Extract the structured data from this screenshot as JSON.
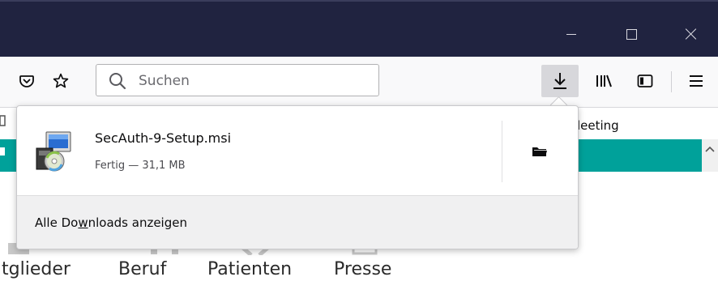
{
  "window": {
    "minimize_label": "—",
    "maximize_label": "□",
    "close_label": "✕"
  },
  "toolbar": {
    "search_placeholder": "Suchen",
    "icons": [
      "pocket-icon",
      "star-icon",
      "search-icon",
      "download-icon",
      "library-icon",
      "sidebar-icon",
      "hamburger-menu-icon"
    ]
  },
  "page": {
    "bookmark_partial": "leeting",
    "nav_links": [
      "tglieder",
      "Beruf",
      "Patienten",
      "Presse"
    ],
    "colors": {
      "teal_bar": "#00a19a",
      "titlebar": "#202340"
    }
  },
  "downloads_panel": {
    "items": [
      {
        "file_name": "SecAuth-9-Setup.msi",
        "status": "Fertig — 31,1 MB"
      }
    ],
    "footer_prefix": "Alle Do",
    "footer_accesskey": "w",
    "footer_suffix": "nloads anzeigen"
  }
}
